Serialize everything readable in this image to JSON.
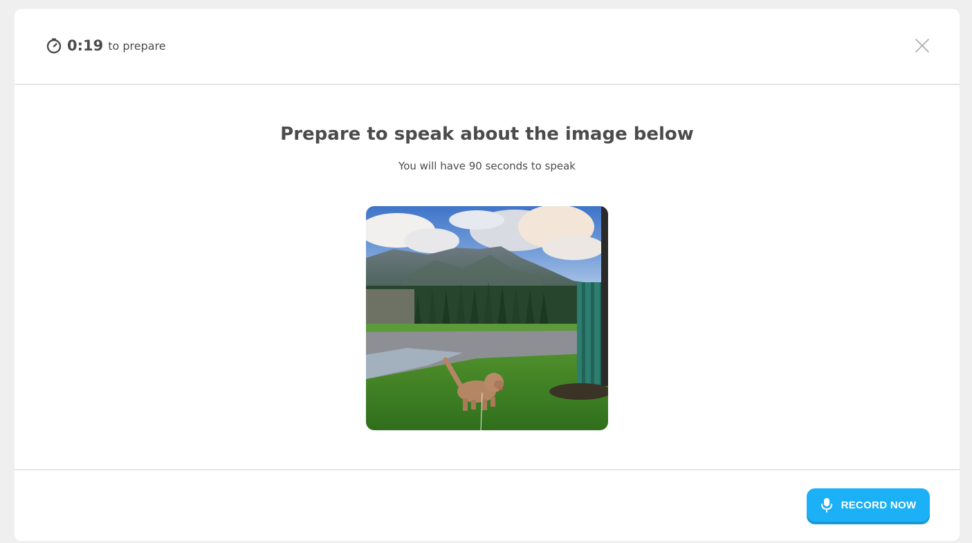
{
  "header": {
    "timer_icon": "stopwatch-icon",
    "timer_value": "0:19",
    "timer_label": "to prepare",
    "close_icon": "close-icon"
  },
  "prompt": {
    "title": "Prepare to speak about the image below",
    "subtitle": "You will have 90 seconds to speak",
    "image_alt": "A fluffy dog running on grass in a park with mountains and trees in the background"
  },
  "footer": {
    "record_icon": "microphone-icon",
    "record_label": "RECORD NOW"
  },
  "colors": {
    "accent": "#1cb0f6",
    "accent_shadow": "#1899d6",
    "text": "#4b4b4b",
    "divider": "#e5e5e5",
    "background": "#efefef"
  }
}
